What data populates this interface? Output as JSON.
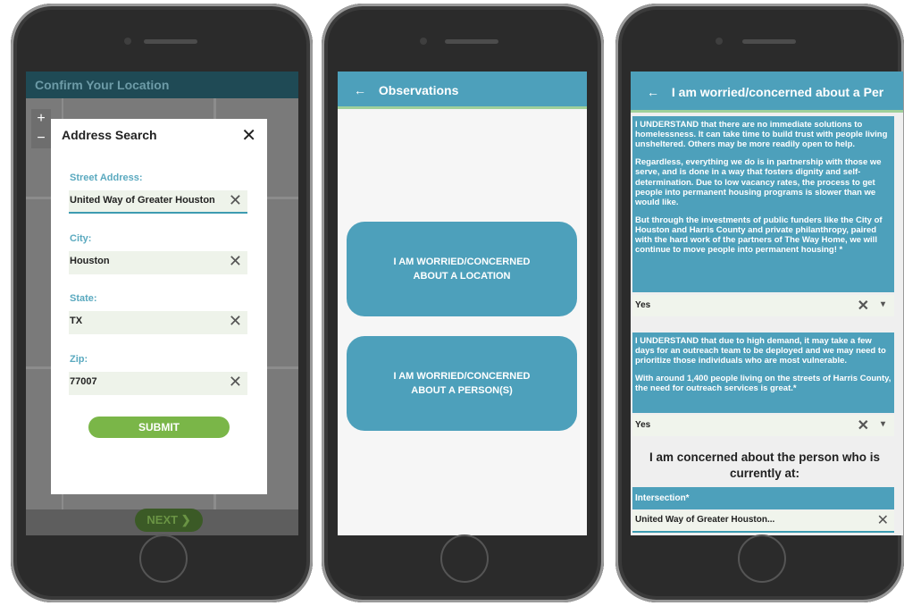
{
  "phone1": {
    "header_title": "Confirm Your Location",
    "zoom_in": "+",
    "zoom_out": "−",
    "next_label": "NEXT ❯",
    "dialog": {
      "title": "Address Search",
      "close": "✕",
      "fields": [
        {
          "label": "Street Address:",
          "value": "United Way of Greater Houston",
          "clear": "✕"
        },
        {
          "label": "City:",
          "value": "Houston",
          "clear": "✕"
        },
        {
          "label": "State:",
          "value": "TX",
          "clear": "✕"
        },
        {
          "label": "Zip:",
          "value": "77007",
          "clear": "✕"
        }
      ],
      "submit_label": "SUBMIT"
    }
  },
  "phone2": {
    "back": "←",
    "header_title": "Observations",
    "buttons": [
      {
        "label": "I AM WORRIED/CONCERNED ABOUT A LOCATION"
      },
      {
        "label": "I AM WORRIED/CONCERNED ABOUT A PERSON(S)"
      }
    ]
  },
  "phone3": {
    "back": "←",
    "header_title": "I am worried/concerned about a Per",
    "info1": {
      "p1": "I UNDERSTAND that there are no immediate solutions to homelessness. It can take time to build trust with people living unsheltered. Others may be more readily open to help.",
      "p2": "Regardless, everything we do is in partnership with those we serve, and is done in a way that fosters dignity and self-determination. Due to low vacancy rates, the process to get people into permanent housing programs is slower than we would like.",
      "p3": "But through the investments of public funders like the City of Houston and Harris County and private philanthropy, paired with the hard work of the partners of The Way Home, we will continue to move people into permanent housing! *"
    },
    "answer1": {
      "value": "Yes",
      "clear": "✕",
      "caret": "▾"
    },
    "info2": {
      "p1": "I UNDERSTAND that due to high demand, it may take a few days for an outreach team to be deployed and we may need to prioritize those individuals who are most vulnerable.",
      "p2": "With around 1,400 people living on the streets of Harris County, the need for outreach services is great.*"
    },
    "answer2": {
      "value": "Yes",
      "clear": "✕",
      "caret": "▾"
    },
    "concern_heading": "I am concerned about the person who is currently at:",
    "intersection_label": "Intersection*",
    "intersection_value": "United Way of Greater Houston...",
    "intersection_clear": "✕"
  }
}
